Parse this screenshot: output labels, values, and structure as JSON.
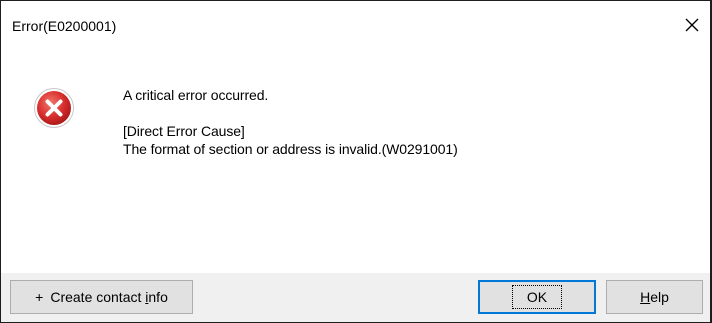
{
  "dialog": {
    "title": "Error(E0200001)",
    "close_icon": "close-icon",
    "error_icon": "error-circle-x-icon"
  },
  "message": {
    "main": "A critical error occurred.",
    "cause_heading": "[Direct Error Cause]",
    "cause_detail": "The format of section or address is invalid.(W0291001)"
  },
  "buttons": {
    "contact_plus": "+",
    "contact_pre": "Create contact ",
    "contact_access_key": "i",
    "contact_post": "nfo",
    "ok_label": "OK",
    "help_access_key": "H",
    "help_post": "elp"
  },
  "colors": {
    "error_red": "#d9302f",
    "focus_blue": "#0078d7",
    "footer_bg": "#f0f0f0"
  }
}
